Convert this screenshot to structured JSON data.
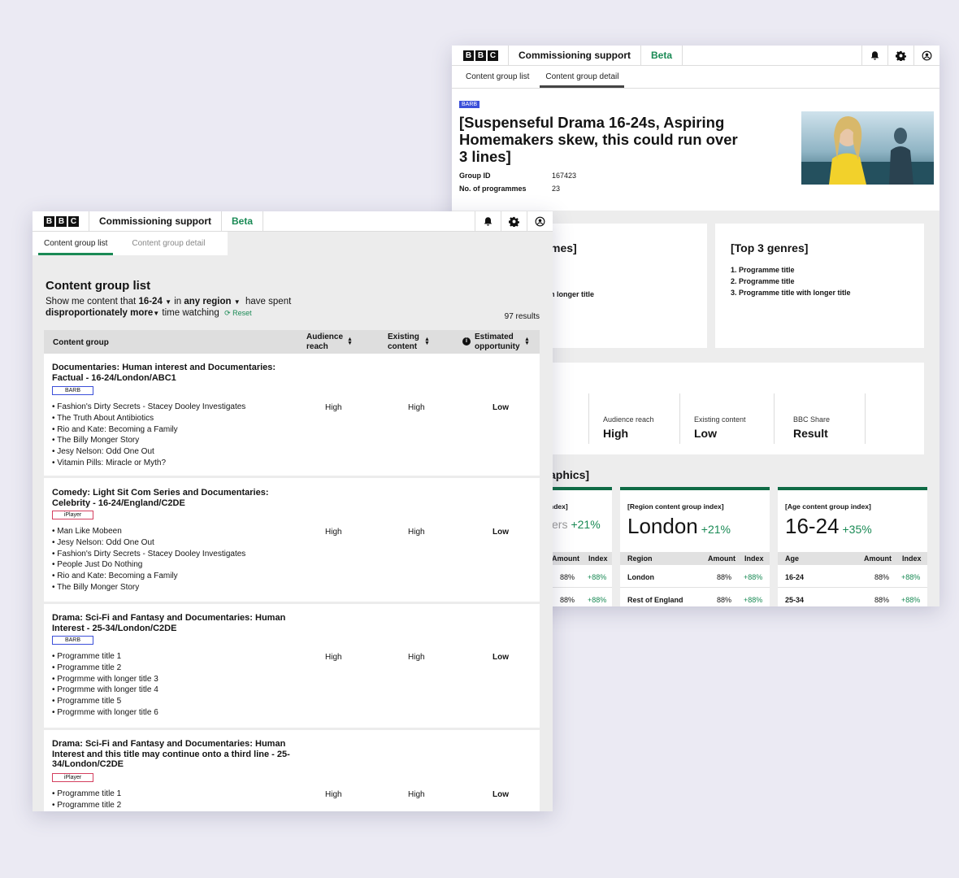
{
  "app": {
    "logo_letters": [
      "B",
      "B",
      "C"
    ],
    "name": "Commissioning support",
    "beta_label": "Beta",
    "tabs": [
      "Content group list",
      "Content group detail"
    ]
  },
  "detail": {
    "source_badge": "BARB",
    "title": "[Suspenseful Drama 16-24s, Aspiring Homemakers skew, this could run over 3 lines]",
    "group_id_label": "Group ID",
    "group_id": "167423",
    "programmes_label": "No. of programmes",
    "programmes_count": "23",
    "top_programmes_title_partial": "mes]",
    "top_programmes_partial_item": "th longer title",
    "top_genres": {
      "title": "[Top 3 genres]",
      "items": [
        "1. Programme title",
        "2. Programme title",
        "3. Programme title with longer title"
      ]
    },
    "stats": [
      {
        "label": "Audience reach",
        "value": "High"
      },
      {
        "label": "Existing content",
        "value": "Low"
      },
      {
        "label": "BBC Share",
        "value": "Result"
      }
    ],
    "demographics_title_partial": "aphics]",
    "demo_cards": [
      {
        "title": "ndex]",
        "big": "ers",
        "pct": "+21%",
        "col_label": "",
        "rows": [
          {
            "label": "",
            "amount": "88%",
            "index": "+88%"
          },
          {
            "label": "",
            "amount": "88%",
            "index": "+88%"
          }
        ]
      },
      {
        "title": "[Region content group index]",
        "big": "London",
        "pct": "+21%",
        "col_label": "Region",
        "rows": [
          {
            "label": "London",
            "amount": "88%",
            "index": "+88%"
          },
          {
            "label": "Rest of England",
            "amount": "88%",
            "index": "+88%"
          }
        ]
      },
      {
        "title": "[Age content group index]",
        "big": "16-24",
        "pct": "+35%",
        "col_label": "Age",
        "rows": [
          {
            "label": "16-24",
            "amount": "88%",
            "index": "+88%"
          },
          {
            "label": "25-34",
            "amount": "88%",
            "index": "+88%"
          }
        ]
      }
    ],
    "amount_label": "Amount",
    "index_label": "Index"
  },
  "list": {
    "heading": "Content group list",
    "filter": {
      "prefix": "Show me content that",
      "age": "16-24",
      "in_word": "in",
      "region": "any region",
      "have_spent": "have spent",
      "direction": "disproportionately more",
      "time_watching": "time watching",
      "reset_label": "Reset"
    },
    "results": "97 results",
    "columns": {
      "content_group": "Content group",
      "audience_reach": [
        "Audience",
        "reach"
      ],
      "existing_content": [
        "Existing",
        "content"
      ],
      "estimated_opportunity": [
        "Estimated",
        "opportunity"
      ]
    },
    "rows": [
      {
        "title": "Documentaries: Human interest and Documentaries: Factual - 16-24/London/ABC1",
        "badge": "BARB",
        "programmes": [
          "Fashion's Dirty Secrets - Stacey Dooley Investigates",
          "The Truth About Antibiotics",
          "Rio and Kate: Becoming a Family",
          "The Billy Monger Story",
          "Jesy Nelson: Odd One Out",
          "Vitamin Pills: Miracle or Myth?"
        ],
        "audience_reach": "High",
        "existing_content": "High",
        "estimated_opportunity": "Low"
      },
      {
        "title": "Comedy: Light Sit Com Series and Documentaries: Celebrity - 16-24/England/C2DE",
        "badge": "iPlayer",
        "programmes": [
          "Man Like Mobeen",
          "Jesy Nelson: Odd One Out",
          "Fashion's Dirty Secrets - Stacey Dooley Investigates",
          "People Just Do Nothing",
          "Rio and Kate: Becoming a Family",
          "The Billy Monger Story"
        ],
        "audience_reach": "High",
        "existing_content": "High",
        "estimated_opportunity": "Low"
      },
      {
        "title": "Drama: Sci-Fi and Fantasy and Documentaries: Human Interest - 25-34/London/C2DE",
        "badge": "BARB",
        "programmes": [
          "Programme title 1",
          "Programme title 2",
          "Progrmme with longer title 3",
          "Progrmme with longer title 4",
          "Programme title 5",
          "Progrmme with longer title 6"
        ],
        "audience_reach": "High",
        "existing_content": "High",
        "estimated_opportunity": "Low"
      },
      {
        "title": "Drama: Sci-Fi and Fantasy and Documentaries: Human Interest  and this title may continue onto a third line  - 25-34/London/C2DE",
        "badge": "iPlayer",
        "programmes": [
          "Programme title 1",
          "Programme title 2"
        ],
        "audience_reach": "High",
        "existing_content": "High",
        "estimated_opportunity": "Low"
      }
    ]
  }
}
